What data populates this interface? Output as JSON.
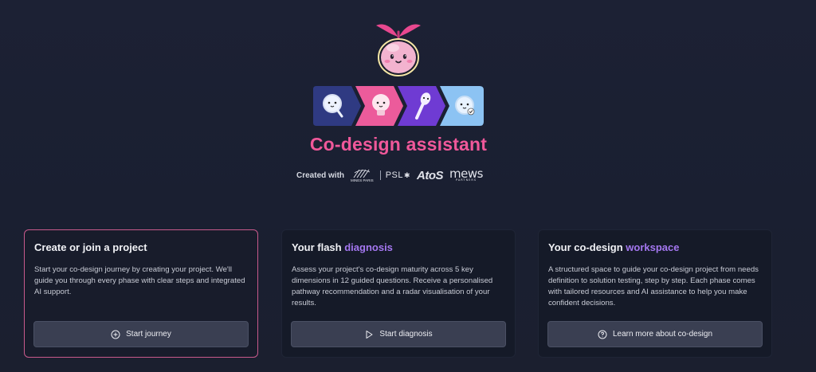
{
  "app": {
    "title": "Co-design assistant",
    "created_with": "Created with",
    "partners": {
      "mines_paris_text": "MINES PARIS",
      "psl": "PSL",
      "atos": "AtoS",
      "mews": "mews",
      "mews_sub": "PARTNERS"
    }
  },
  "phases": [
    "magnifier-icon",
    "lightbulb-icon",
    "brush-icon",
    "checkmark-icon"
  ],
  "colors": {
    "accent_pink": "#f0589a",
    "accent_purple": "#a477f0",
    "phase_navy": "#2f3a82",
    "phase_pink": "#ec5b9b",
    "phase_purple": "#6f3bd3",
    "phase_lightblue": "#8cc3f3"
  },
  "cards": [
    {
      "title": "Create or join a project",
      "title_plain": "",
      "title_accent": "",
      "description": "Start your co-design journey by creating your project. We'll guide you through every phase with clear steps and integrated AI support.",
      "button_label": "Start journey",
      "button_icon": "plus-circle-icon"
    },
    {
      "title": "",
      "title_plain": "Your flash",
      "title_accent": "diagnosis",
      "description": "Assess your project's co-design maturity across 5 key dimensions in 12 guided questions. Receive a personalised pathway recommendation and a radar visualisation of your results.",
      "button_label": "Start diagnosis",
      "button_icon": "play-icon"
    },
    {
      "title": "",
      "title_plain": "Your co-design",
      "title_accent": "workspace",
      "description": "A structured space to guide your co-design project from needs definition to solution testing, step by step. Each phase comes with tailored resources and AI assistance to help you make confident decisions.",
      "button_label": "Learn more about co-design",
      "button_icon": "help-circle-icon"
    }
  ]
}
